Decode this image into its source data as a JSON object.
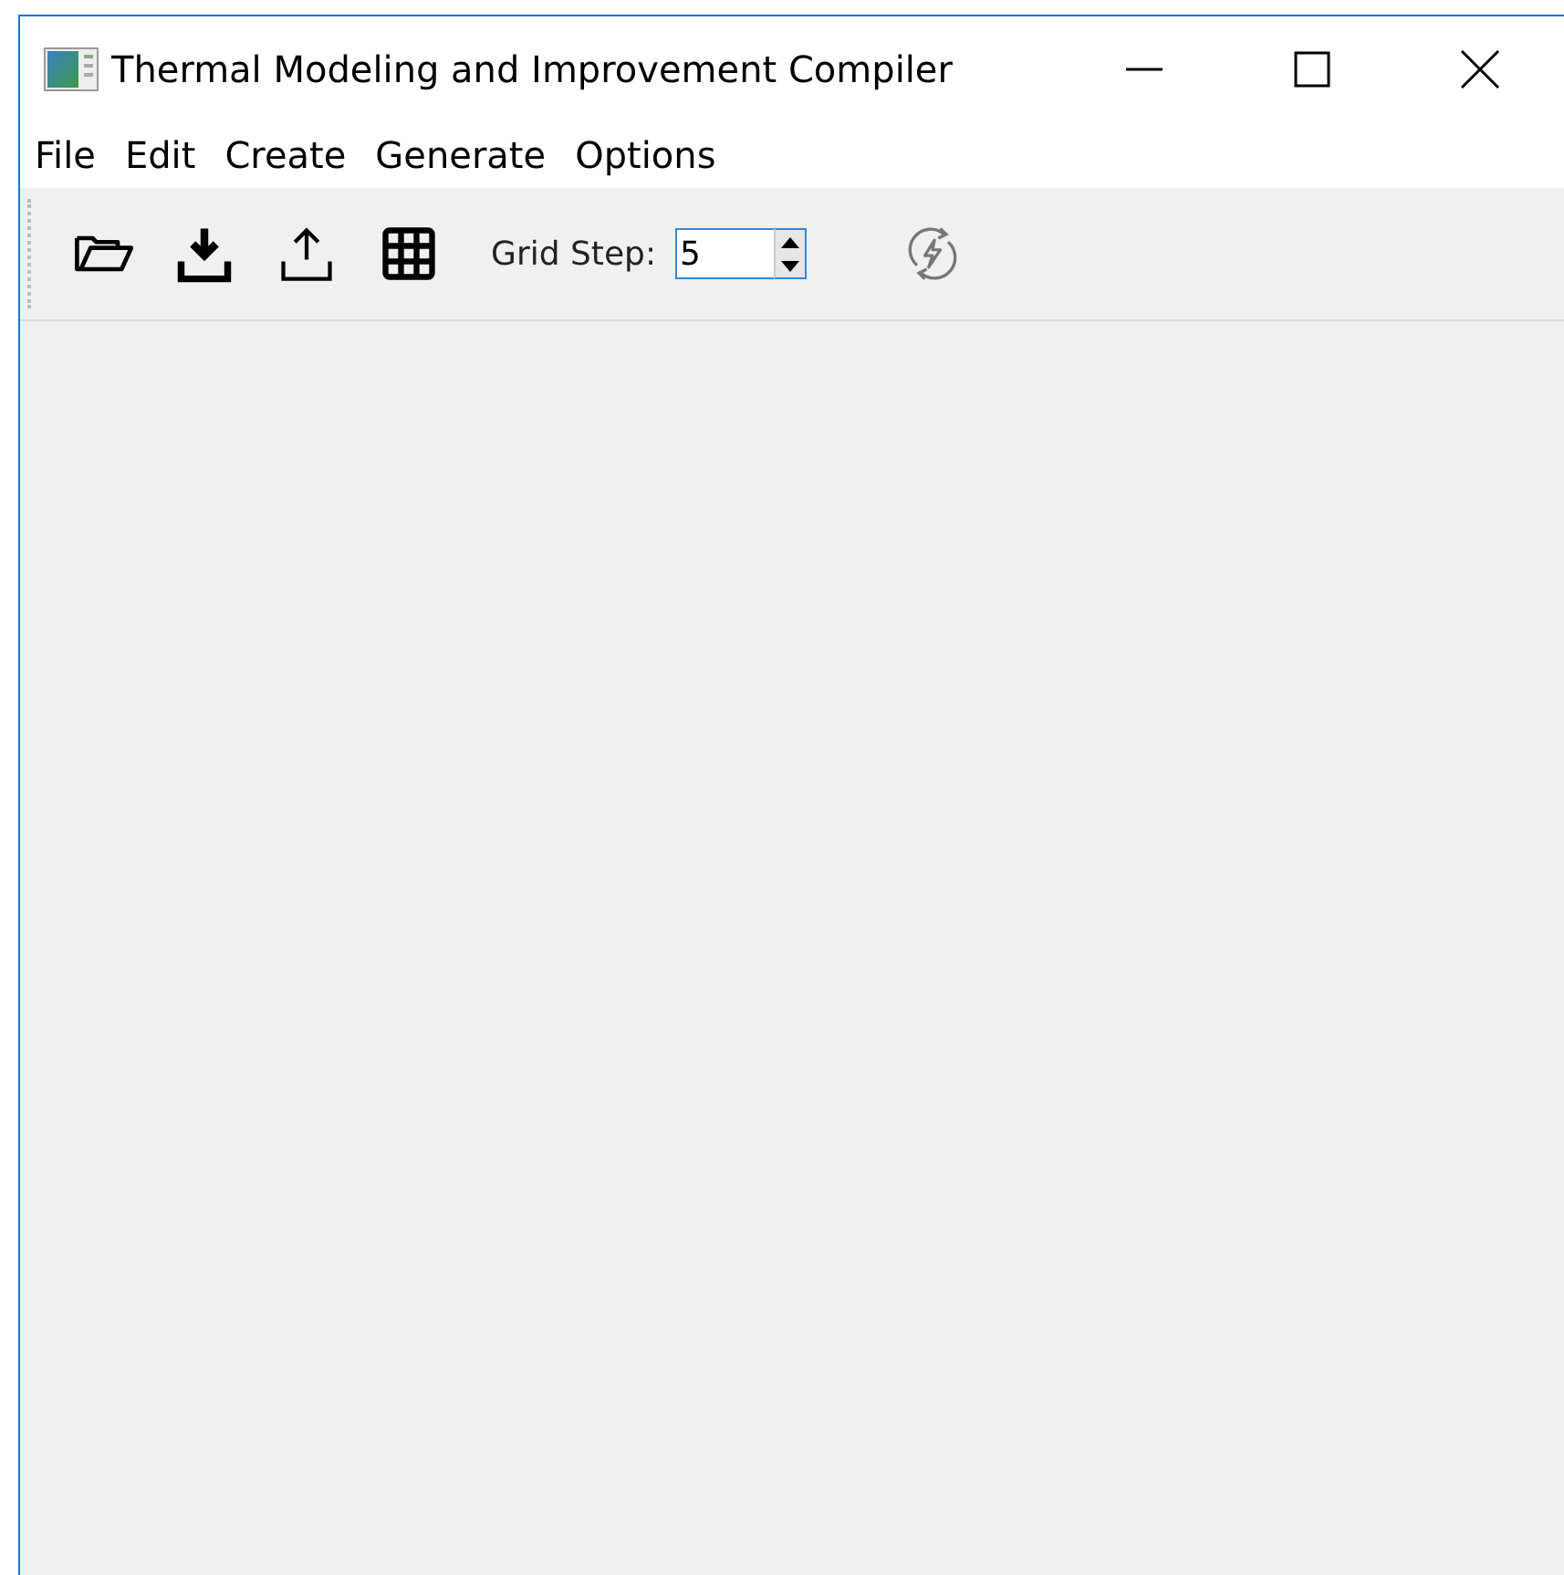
{
  "window": {
    "title": "Thermal Modeling and Improvement Compiler"
  },
  "menu": [
    "File",
    "Edit",
    "Create",
    "Generate",
    "Options"
  ],
  "toolbar": {
    "tools": [
      {
        "kind": "open",
        "disabled": false
      },
      {
        "kind": "download",
        "disabled": false
      },
      {
        "kind": "upload",
        "disabled": false
      },
      {
        "kind": "grid",
        "disabled": false
      }
    ],
    "grid_step": {
      "label": "Grid Step:",
      "value": "5"
    },
    "action": {
      "kind": "regenerate",
      "disabled": true
    }
  }
}
